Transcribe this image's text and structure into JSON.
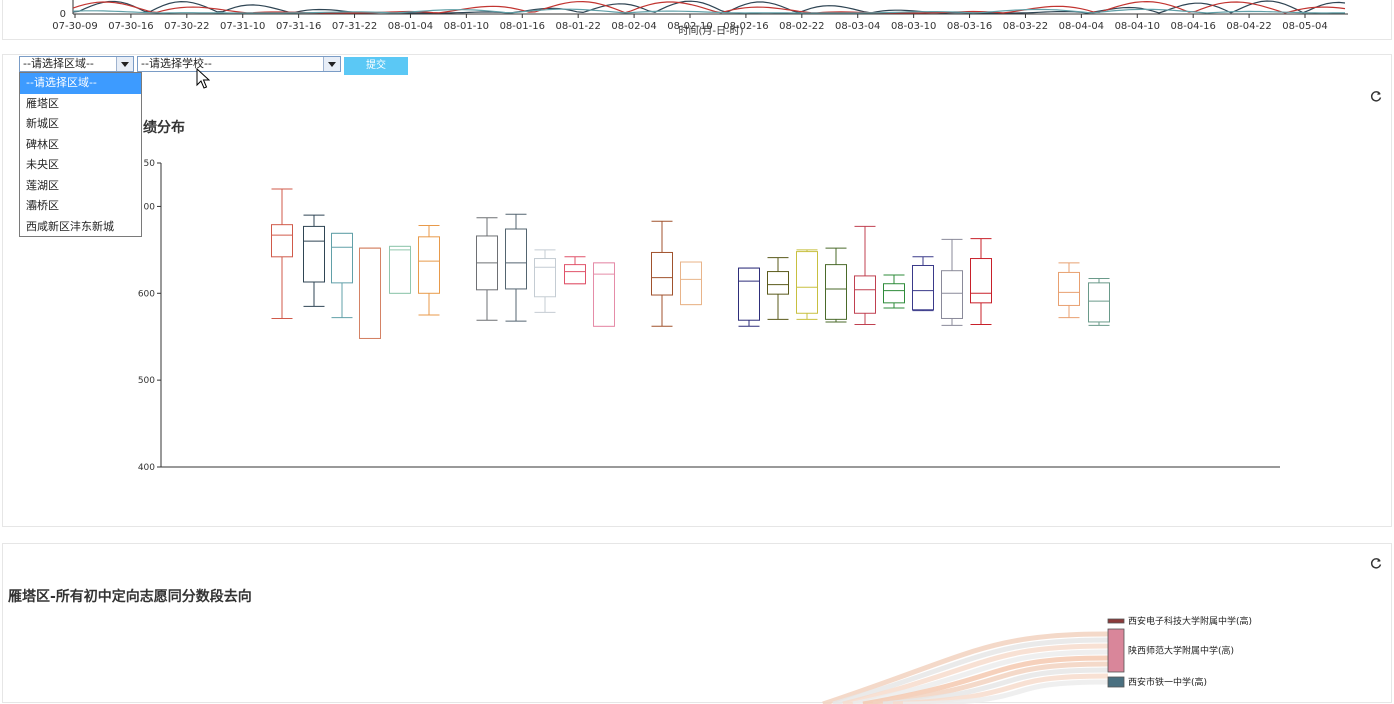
{
  "top_chart": {
    "x_ticks": [
      "07-30-09",
      "07-30-16",
      "07-30-22",
      "07-31-10",
      "07-31-16",
      "07-31-22",
      "08-01-04",
      "08-01-10",
      "08-01-16",
      "08-01-22",
      "08-02-04",
      "08-02-10",
      "08-02-16",
      "08-02-22",
      "08-03-04",
      "08-03-10",
      "08-03-16",
      "08-03-22",
      "08-04-04",
      "08-04-10",
      "08-04-16",
      "08-04-22",
      "08-05-04"
    ],
    "y_zero": "0",
    "x_label": "时间(月-日-时)",
    "series_colors": [
      "#2f4554",
      "#c23531",
      "#61a0a8"
    ]
  },
  "controls": {
    "region_select": "--请选择区域--",
    "school_select": "--请选择学校--",
    "submit_label": "提交",
    "region_options": [
      "--请选择区域--",
      "雁塔区",
      "新城区",
      "碑林区",
      "未央区",
      "莲湖区",
      "灞桥区",
      "西咸新区沣东新城"
    ]
  },
  "box_chart": {
    "title_visible": "绩分布"
  },
  "sankey": {
    "title": "雁塔区-所有初中定向志愿同分数段去向",
    "nodes": [
      {
        "name": "西安电子科技大学附属中学(高)",
        "color": "#8b3a3a"
      },
      {
        "name": "陕西师范大学附属中学(高)",
        "color": "#d9869a"
      },
      {
        "name": "西安市铁一中学(高)",
        "color": "#4a7080"
      }
    ]
  },
  "chart_data": {
    "type": "boxplot",
    "ylim": [
      400,
      750
    ],
    "yticks": [
      400,
      500,
      600,
      700,
      750
    ],
    "ytick_labels": [
      "400",
      "500",
      "600",
      "00",
      "50"
    ],
    "boxes": [
      {
        "min": 571,
        "q1": 642,
        "median": 667,
        "q3": 679,
        "max": 720,
        "color": "#d05a4a"
      },
      {
        "min": 585,
        "q1": 613,
        "median": 660,
        "q3": 677,
        "max": 690,
        "color": "#2f4554"
      },
      {
        "min": 572,
        "q1": 612,
        "median": 653,
        "q3": 669,
        "max": 669,
        "color": "#61a0a8"
      },
      {
        "min": 548,
        "q1": 548,
        "median": 652,
        "q3": 652,
        "max": 652,
        "color": "#d48265"
      },
      {
        "min": 600,
        "q1": 600,
        "median": 650,
        "q3": 654,
        "max": 654,
        "color": "#91c7ae"
      },
      {
        "min": 575,
        "q1": 600,
        "median": 637,
        "q3": 665,
        "max": 678,
        "color": "#e89a4a"
      },
      {
        "min": 569,
        "q1": 604,
        "median": 635,
        "q3": 666,
        "max": 687,
        "color": "#6e7074"
      },
      {
        "min": 568,
        "q1": 605,
        "median": 635,
        "q3": 674,
        "max": 691,
        "color": "#546570"
      },
      {
        "min": 578,
        "q1": 596,
        "median": 630,
        "q3": 640,
        "max": 650,
        "color": "#c4ccd3"
      },
      {
        "min": 611,
        "q1": 611,
        "median": 625,
        "q3": 633,
        "max": 642,
        "color": "#e0536a"
      },
      {
        "min": 562,
        "q1": 562,
        "median": 622,
        "q3": 635,
        "max": 635,
        "color": "#e58ca8"
      },
      {
        "min": 562,
        "q1": 598,
        "median": 618,
        "q3": 647,
        "max": 683,
        "color": "#a0522d"
      },
      {
        "min": 587,
        "q1": 587,
        "median": 616,
        "q3": 636,
        "max": 636,
        "color": "#e8b48a"
      },
      {
        "min": 562,
        "q1": 569,
        "median": 614,
        "q3": 629,
        "max": 629,
        "color": "#2e2e7a"
      },
      {
        "min": 570,
        "q1": 599,
        "median": 610,
        "q3": 625,
        "max": 641,
        "color": "#5a5a1a"
      },
      {
        "min": 570,
        "q1": 577,
        "median": 607,
        "q3": 648,
        "max": 650,
        "color": "#c8c040"
      },
      {
        "min": 567,
        "q1": 570,
        "median": 605,
        "q3": 633,
        "max": 652,
        "color": "#4a6a2a"
      },
      {
        "min": 564,
        "q1": 577,
        "median": 604,
        "q3": 620,
        "max": 677,
        "color": "#c04050"
      },
      {
        "min": 583,
        "q1": 589,
        "median": 603,
        "q3": 611,
        "max": 621,
        "color": "#2e8b3a"
      },
      {
        "min": 580,
        "q1": 581,
        "median": 603,
        "q3": 632,
        "max": 642,
        "color": "#3a3a8a"
      },
      {
        "min": 563,
        "q1": 571,
        "median": 600,
        "q3": 626,
        "max": 662,
        "color": "#8a8a9a"
      },
      {
        "min": 564,
        "q1": 589,
        "median": 600,
        "q3": 640,
        "max": 663,
        "color": "#c8202a"
      },
      {
        "min": 572,
        "q1": 586,
        "median": 601,
        "q3": 624,
        "max": 635,
        "color": "#e8a070"
      },
      {
        "min": 563,
        "q1": 567,
        "median": 591,
        "q3": 612,
        "max": 617,
        "color": "#6a9a8a"
      }
    ]
  }
}
